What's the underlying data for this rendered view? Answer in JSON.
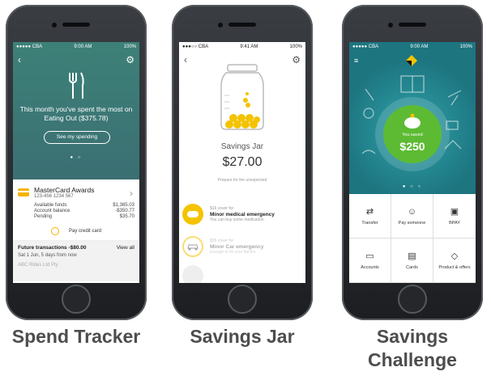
{
  "captions": [
    "Spend Tracker",
    "Savings Jar",
    "Savings Challenge"
  ],
  "spend_tracker": {
    "status": {
      "carrier": "●●●●● CBA",
      "time": "9:00 AM",
      "battery": "100%"
    },
    "headline": "This month you've spent the most on Eating Out ($375.78)",
    "button": "See my spending",
    "card": {
      "name": "MasterCard Awards",
      "number": "123-456 1234 567"
    },
    "funds": [
      {
        "label": "Available funds",
        "value": "$1,365.03"
      },
      {
        "label": "Account balance",
        "value": "-$350.77"
      },
      {
        "label": "Pending",
        "value": "$35.70"
      }
    ],
    "pay": "Pay credit card",
    "future": {
      "title": "Future transactions -$80.00",
      "view": "View all",
      "date": "Sat 1 Jun, 5 days from now",
      "next": "ABC Rides Ltd Pty"
    }
  },
  "savings_jar": {
    "status": {
      "carrier": "●●●○○ CBA",
      "time": "9:41 AM",
      "battery": "100%"
    },
    "title": "Savings Jar",
    "amount": "$27.00",
    "subtitle": "Prepare for the unexpected",
    "goals": [
      {
        "cover": "$16 cover for",
        "title": "Minor medical emergency",
        "desc": "You can buy some medication"
      },
      {
        "cover": "$35 cover for",
        "title": "Minor Car emergency",
        "desc": "Enough to fix your flat tire"
      }
    ]
  },
  "savings_challenge": {
    "status": {
      "carrier": "●●●●● CBA",
      "time": "9:00 AM",
      "battery": "100%"
    },
    "saved_label": "You saved",
    "saved_amount": "$250",
    "tiles": [
      {
        "label": "Transfer",
        "icon": "transfer-icon"
      },
      {
        "label": "Pay someone",
        "icon": "person-icon"
      },
      {
        "label": "BPAY",
        "icon": "bpay-icon"
      },
      {
        "label": "Accounts",
        "icon": "wallet-icon"
      },
      {
        "label": "Cards",
        "icon": "card-icon"
      },
      {
        "label": "Product & offers",
        "icon": "tag-icon"
      }
    ]
  },
  "colors": {
    "teal": "#3b7875",
    "yellow": "#f4c300",
    "green": "#5cbb33"
  }
}
